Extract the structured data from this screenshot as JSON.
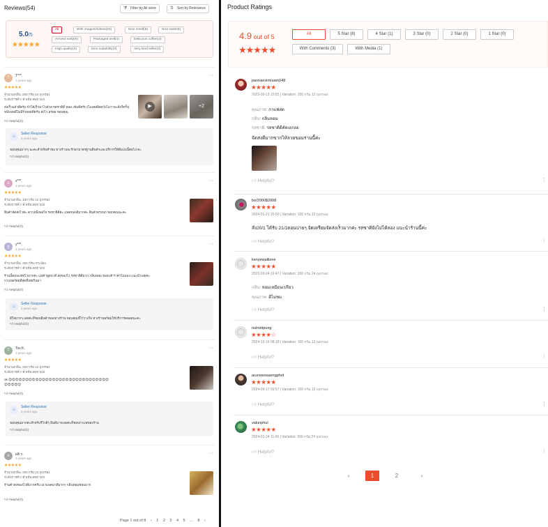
{
  "left": {
    "title": "Reviews(54)",
    "filter_store_label": "Filter by All store",
    "sort_label": "Sort by Relevance",
    "summary": {
      "score": "5.0",
      "out_of": "/5",
      "stars": "★★★★★",
      "chips": [
        "All",
        "With images/videos(33)",
        "Nice smell(8)",
        "Nice taste(9)",
        "Arrived early(9)",
        "Packaged well(4)",
        "Delicious coffee(3)",
        "High quality(3)",
        "Nice suitability(3)",
        "Very kind seller(3)"
      ]
    },
    "reviews": [
      {
        "initial": "T",
        "name": "T***.",
        "date": "3 years ago",
        "stars": "★★★★★",
        "line1": "จำนวน/กลิ่น: 200 กรัม 24 ถุงกรอง",
        "line2": "ระดับการคั่ว: คั่วเข้ม-คอกาแฟ",
        "text1": "ส่งเร็วแล้วดีครับ บ้าได้เร็วมาไวด้วย รสชาติดี หอม เข้มดีครับ (ไม่เคยผิดหวังไม่ว่าจะสั่งกี่ครั้ง)",
        "text2": "หนีบห่อดีไม่มีรั่วยอดดีครับ ส่งไว อร่อย ขอบคุณ",
        "more_count": "+2",
        "helpful": "Helpful(0)",
        "seller_title": "Seller Response",
        "seller_date": "3 years ago",
        "seller_text": "ขอบคุณมากๆ นะคะสำหรับคำชม ทางร้านจะรักษามาตรฐานสินค้าและบริการให้ดีแบบนี้ต่อไป คะ",
        "seller_help": "Helpful(0)"
      },
      {
        "initial": "s",
        "name": "s***.",
        "date": "3 years ago",
        "stars": "★★★★★",
        "line1": "จำนวน/กลิ่น: 100 กรัม 12 ถุงกรอง",
        "line2": "ระดับการคั่ว: คั่วเข้ม-คอกาแฟ",
        "text1": "สินค้าจัดส่งไวค่ะ ความพึงพอใจ รสชาติดีค่ะ แพคของดีมากค่ะ สินค้าตรงปก ขอบคุณนะคะ",
        "helpful": "Helpful(0)"
      },
      {
        "initial": "y",
        "name": "y***.",
        "date": "3 years ago",
        "stars": "★★★★★",
        "line1": "จำนวน/กลิ่น: 200 กรัม-กระป๋อง",
        "line2": "ระดับการคั่ว: คั่วเข้ม-คอกาแฟ",
        "text1": "ร้านนี้ตอบแชทไวมากค่ะ แม่ค้าพูดจาดี ส่งของไว รสชาติดีมาก กลิ่นหอม ของแท้ ราคาไม่แพง แนะนำเลยค่ะ",
        "text2": "กาแฟอร่อยที่สุดที่เคยกินมา",
        "helpful": "Helpful(0)",
        "seller_title": "Seller Response",
        "seller_date": "3 years ago",
        "seller_text": "ดีใจมากๆ เลยค่ะที่ชอบสินค้าของทางร้าน ขอบคุณที่ไว้วางใจ ทางร้านพร้อมให้บริการตลอดนะคะ",
        "seller_help": "Helpful(0)"
      },
      {
        "initial": "T",
        "name": "Tos K.",
        "date": "3 years ago",
        "stars": "★★★★★",
        "line1": "จำนวน/กลิ่น: 200 กรัม 24 ถุงกรอง",
        "line2": "ระดับการคั่ว: คั่วเข้ม-คอกาแฟ",
        "text1": "ok 😍😍😍😍😍😍😍😍😍😍😍😍😍😍😍😍😍😍😍😍😍😍😍😍😍😍😍😍😍😍",
        "text2": "😍😍😍😍😍",
        "helpful": "Helpful(0)",
        "seller_title": "Seller Response",
        "seller_date": "3 years ago",
        "seller_text": "ขอบคุณมากค่ะสำหรับรีวิวดีๆ ยินดีมากเลยค่ะที่ชอบกาแฟของร้าน",
        "seller_help": "Helpful(0)"
      },
      {
        "initial": "s",
        "name": "ผลิ ร.",
        "date": "3 years ago",
        "stars": "★★★★★",
        "line1": "จำนวน/กลิ่น: 200 กรัม 24 ถุงกรอง",
        "line2": "ระดับการคั่ว: คั่วเข้ม-คอกาแฟ",
        "text1": "ร้านค้าส่งของไวดีมากครับ เอาแพคมาดีมากๆ กลิ่นหอมชอบมาก",
        "helpful": "Helpful(0)"
      }
    ],
    "pager": {
      "label": "Page 1 out of 8",
      "prev": "‹",
      "pages": [
        "1",
        "2",
        "3",
        "4",
        "5",
        "...",
        "8"
      ],
      "next": "›"
    }
  },
  "right": {
    "title": "Product Ratings",
    "score": "4.9",
    "out_of": " out of 5",
    "stars": "★★★★★",
    "filters": [
      "All",
      "5 Star (8)",
      "4 Star (1)",
      "3 Star (0)",
      "2 Star (0)",
      "1 Star (0)",
      "With Comments (3)",
      "With Media (1)"
    ],
    "reviews": [
      {
        "name": "pannaovintrsam048",
        "stars": "★★★★★",
        "meta": "2023-09-13 15:55 | Variation: 100 กรัม 12 ถุงกรอง",
        "kv": [
          [
            "คุณภาพ: ",
            "กาแฟสด"
          ],
          [
            "กลิ่น: ",
            "กลิ่นหอม"
          ],
          [
            "รสชาติ: ",
            "รสชาติดีคัดเอรอย"
          ]
        ],
        "text": "จัดส่งดีมากขากไห้ลวยขอมร่านนี้ค่ะ",
        "helpful": "Helpful?"
      },
      {
        "name": "bo/2000$2008",
        "stars": "★★★★★",
        "meta": "2024-01-21 16:50 | Variation: 100 กรัม 12 ถุงกรอง",
        "text": "สั่ง20/1 ได้รับ 21/1ตอนบ่ายๆ จัดเตรียมจัดส่งเร็วมากค่ะ รสชาติยังไม่ได้ลอง แนะนำร้านนี้ค่ะ",
        "helpful": "Helpful?"
      },
      {
        "name": "kenyewalliene",
        "stars": "★★★★★",
        "meta": "2023-03-04 16:47 | Variation: 200 กรัม 24 ถุงกรอง",
        "kv": [
          [
            "กลิ่น: ",
            "หอมเหมือนเปรียว"
          ],
          [
            "คุณภาพ: ",
            "ดีไม่ชม"
          ]
        ],
        "helpful": "Helpful?"
      },
      {
        "name": "nulnsttpung",
        "stars": "★★★★☆",
        "meta": "2024-10-16 08:18 | Variation: 100 กรัม 12 ถุงกรอง",
        "helpful": "Helpful?"
      },
      {
        "name": "arunwessaengphol",
        "stars": "★★★★★",
        "meta": "2024-09-17 09:57 | Variation: 100 กรัม 12 ถุงกรอง",
        "helpful": "Helpful?"
      },
      {
        "name": "valunphul",
        "stars": "★★★★★",
        "meta": "2024-01-24 11:06 | Variation: 200 กรัม 24 ถุงกรอง",
        "helpful": "Helpful?"
      }
    ],
    "pager": {
      "prev": "‹",
      "pages": [
        "1",
        "2"
      ],
      "next": "›"
    },
    "more_icon": "⋮"
  },
  "colors": {
    "accent": "#ee4d2d",
    "star_left": "#f5a623",
    "link_blue": "#2d6fb8",
    "summary_bg": "#fffbf8"
  }
}
